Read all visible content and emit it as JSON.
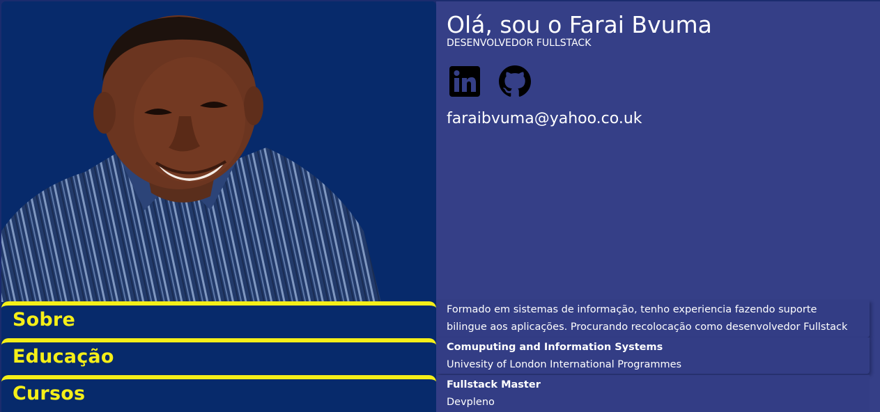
{
  "profile": {
    "greeting": "Olá, sou o Farai Bvuma",
    "role": "DESENVOLVEDOR FULLSTACK",
    "email": "faraibvuma@yahoo.co.uk",
    "photo_alt": "foto de Farai Bvuma"
  },
  "social": [
    {
      "name": "linkedin",
      "icon": "linkedin-icon"
    },
    {
      "name": "github",
      "icon": "github-icon"
    }
  ],
  "nav": {
    "sobre": "Sobre",
    "educacao": "Educação",
    "cursos": "Cursos"
  },
  "sections": {
    "sobre": {
      "line1": "Formado em sistemas de informação, tenho experiencia fazendo suporte",
      "line2": "bilingue aos aplicações. Procurando recolocação como desenvolvedor Fullstack"
    },
    "educacao": {
      "title": "Comuputing and Information Systems",
      "institution": "Univesity of London International Programmes"
    },
    "cursos": {
      "title": "Fullstack Master",
      "institution": "Devpleno"
    }
  },
  "colors": {
    "background": "#1b2c6e",
    "left_panel": "#072a6b",
    "right_panel": "#353f87",
    "accent_yellow": "#f5ef18",
    "text": "#ffffff"
  }
}
